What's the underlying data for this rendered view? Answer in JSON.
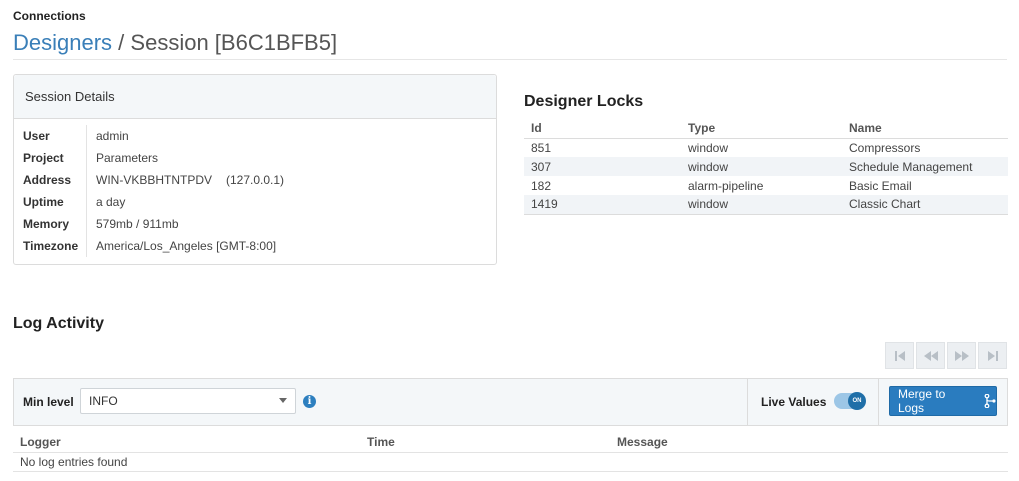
{
  "header": {
    "section": "Connections",
    "breadcrumb_link": "Designers",
    "separator": "/",
    "title": "Session [B6C1BFB5]"
  },
  "session_details": {
    "heading": "Session Details",
    "rows": [
      {
        "label": "User",
        "value": "admin"
      },
      {
        "label": "Project",
        "value": "Parameters"
      },
      {
        "label": "Address",
        "value": "WIN-VKBBHTNTPDV",
        "extra": "(127.0.0.1)"
      },
      {
        "label": "Uptime",
        "value": "a day"
      },
      {
        "label": "Memory",
        "value": "579mb / 911mb"
      },
      {
        "label": "Timezone",
        "value": "America/Los_Angeles [GMT-8:00]"
      }
    ]
  },
  "designer_locks": {
    "heading": "Designer Locks",
    "columns": [
      "Id",
      "Type",
      "Name"
    ],
    "rows": [
      [
        "851",
        "window",
        "Compressors"
      ],
      [
        "307",
        "window",
        "Schedule Management"
      ],
      [
        "182",
        "alarm-pipeline",
        "Basic Email"
      ],
      [
        "1419",
        "window",
        "Classic Chart"
      ]
    ]
  },
  "log_activity": {
    "heading": "Log Activity",
    "pager_icons": [
      "first-page-icon",
      "previous-page-icon",
      "next-page-icon",
      "last-page-icon"
    ],
    "min_level_label": "Min level",
    "min_level_value": "INFO",
    "live_values_label": "Live Values",
    "toggle_text": "ON",
    "merge_button": "Merge to Logs",
    "columns": [
      "Logger",
      "Time",
      "Message"
    ],
    "empty_message": "No log entries found"
  },
  "colors": {
    "accent": "#2a7cbf",
    "link": "#3a7fb8",
    "panel_bg": "#f4f7f9"
  }
}
